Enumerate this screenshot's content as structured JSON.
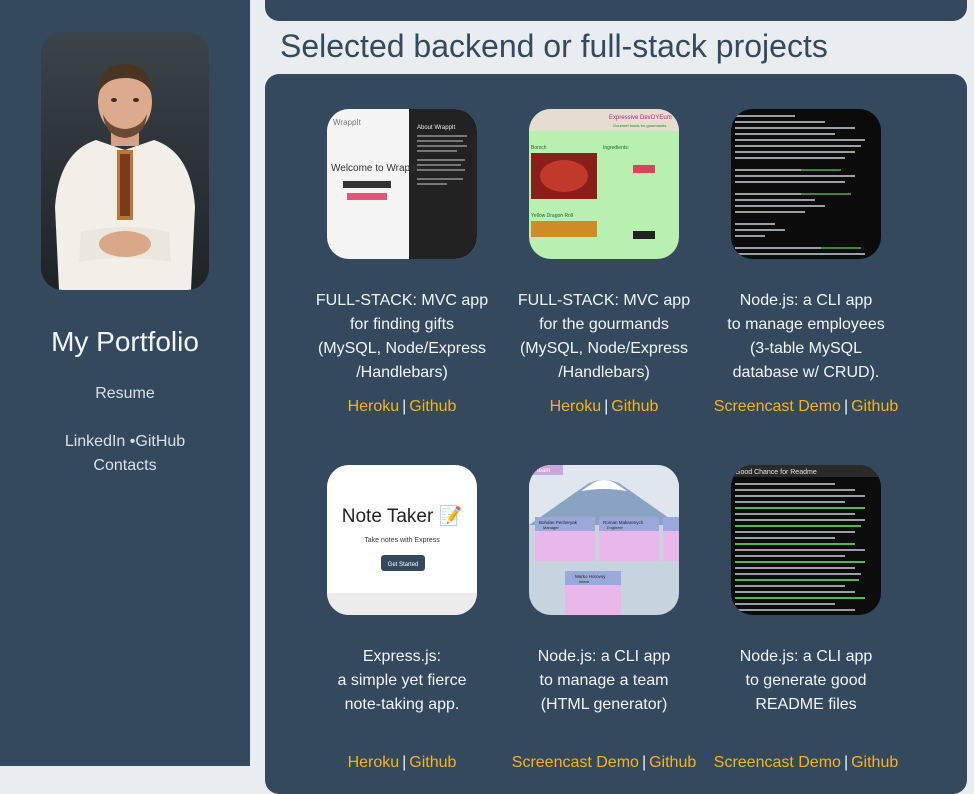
{
  "sidebar": {
    "brand": "My Portfolio",
    "resume": "Resume",
    "linkedin": "LinkedIn",
    "bullet": "•",
    "github": "GitHub",
    "contacts": "Contacts"
  },
  "main": {
    "section_title": "Selected backend or full-stack projects"
  },
  "projects": [
    {
      "description": "FULL-STACK: MVC app\nfor finding gifts\n(MySQL, Node/Express\n/Handlebars)",
      "link1": "Heroku",
      "link2": "Github",
      "thumb_title": "Welcome to WrappIt",
      "thumb_brand": "WrappIt",
      "thumb_side": "About WrappIt"
    },
    {
      "description": "FULL-STACK: MVC app\nfor the gourmands\n(MySQL, Node/Express\n/Handlebars)",
      "link1": "Heroku",
      "link2": "Github",
      "thumb_title": "Expressive DevOYEum",
      "thumb_sub": "Gourmet foods for gourmands",
      "thumb_item1": "Borsch",
      "thumb_item2": "Yellow Dragon Roll",
      "thumb_ing": "Ingredients:"
    },
    {
      "description": "Node.js: a CLI app\nto manage employees\n(3-table MySQL\ndatabase w/ CRUD).",
      "link1": "Screencast Demo",
      "link2": "Github"
    },
    {
      "description": "Express.js:\na simple yet fierce\nnote-taking app.",
      "link1": "Heroku",
      "link2": "Github",
      "thumb_title": "Note Taker 📝",
      "thumb_sub": "Take notes with Express",
      "thumb_button": "Get Started"
    },
    {
      "description": "Node.js: a CLI app\nto manage a team\n(HTML generator)",
      "link1": "Screencast Demo",
      "link2": "Github",
      "thumb_tag": "team",
      "thumb_card1": "Bohdan Pecheryak",
      "thumb_role1": "Manager",
      "thumb_card2": "Roman Makarenych",
      "thumb_role2": "Engineer",
      "thumb_card3": "Marko Horovoy",
      "thumb_role3": "Intern"
    },
    {
      "description": "Node.js: a CLI app\nto generate good\nREADME files",
      "link1": "Screencast Demo",
      "link2": "Github",
      "thumb_title": "Good Chance for Readme"
    }
  ],
  "colors": {
    "sidebar_bg": "#34495e",
    "page_bg": "#e9edf0",
    "link": "#f5b321",
    "title": "#34495e"
  }
}
